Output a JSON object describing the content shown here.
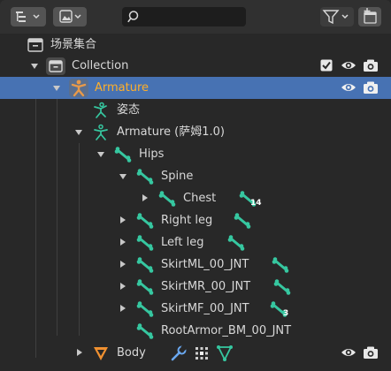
{
  "outliner": {
    "scene_collection_label": "场景集合",
    "rows": [
      {
        "label": "Collection"
      },
      {
        "label": "Armature"
      },
      {
        "label": "姿态"
      },
      {
        "label": "Armature (萨姆1.0)"
      },
      {
        "label": "Hips"
      },
      {
        "label": "Spine"
      },
      {
        "label": "Chest",
        "badge": "14"
      },
      {
        "label": "Right leg"
      },
      {
        "label": "Left leg"
      },
      {
        "label": "SkirtML_00_JNT"
      },
      {
        "label": "SkirtMR_00_JNT"
      },
      {
        "label": "SkirtMF_00_JNT",
        "badge": "3"
      },
      {
        "label": "RootArmor_BM_00_JNT"
      },
      {
        "label": "Body"
      }
    ]
  },
  "colors": {
    "background": "#282828",
    "selected_row": "#4772b3",
    "bone_green": "#36c7a0",
    "armature_orange": "#e89a4a",
    "mesh_orange": "#f09030",
    "selected_text": "#ffaf29"
  },
  "icons": [
    "display-mode-icon",
    "view-layer-icon",
    "search-icon",
    "filter-icon",
    "new-collection-icon",
    "collection-icon",
    "checkbox-icon",
    "eye-icon",
    "camera-icon",
    "armature-icon",
    "pose-icon",
    "armature-data-icon",
    "bone-icon",
    "mesh-icon",
    "wrench-icon",
    "modifier-icon",
    "vertex-group-icon"
  ]
}
